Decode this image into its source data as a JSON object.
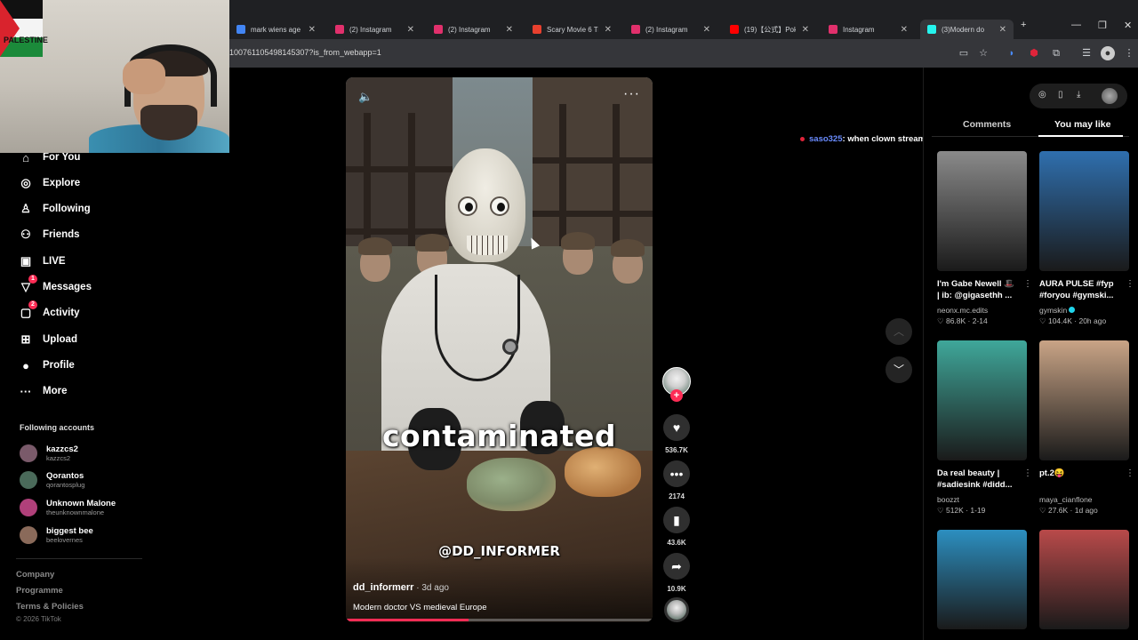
{
  "browser": {
    "tabs": [
      {
        "title": "mark wiens age -",
        "color": "#4285f4"
      },
      {
        "title": "(2) Instagram",
        "color": "#e1306c"
      },
      {
        "title": "(2) Instagram",
        "color": "#e1306c"
      },
      {
        "title": "Scary Movie 6 Tra",
        "color": "#e8402e"
      },
      {
        "title": "(2) Instagram",
        "color": "#e1306c"
      },
      {
        "title": "(19)【公式】Pokém",
        "color": "#ff0000"
      },
      {
        "title": "Instagram",
        "color": "#e1306c"
      },
      {
        "title": "(3)Modern do",
        "color": "#25f4ee"
      }
    ],
    "url": "100761105498145307?is_from_webapp=1"
  },
  "webcam": {
    "flag_text": "PALESTINE"
  },
  "nav": {
    "items": [
      {
        "label": "For You",
        "icon": "home-icon"
      },
      {
        "label": "Explore",
        "icon": "compass-icon"
      },
      {
        "label": "Following",
        "icon": "following-icon"
      },
      {
        "label": "Friends",
        "icon": "friends-icon"
      },
      {
        "label": "LIVE",
        "icon": "live-icon"
      },
      {
        "label": "Messages",
        "icon": "messages-icon",
        "badge": "1"
      },
      {
        "label": "Activity",
        "icon": "activity-icon",
        "badge": "2"
      },
      {
        "label": "Upload",
        "icon": "upload-icon"
      },
      {
        "label": "Profile",
        "icon": "profile-icon"
      },
      {
        "label": "More",
        "icon": "more-icon"
      }
    ],
    "following_title": "Following accounts",
    "accounts": [
      {
        "name": "kazzcs2",
        "handle": "kazzcs2",
        "color": "#7a5a6a"
      },
      {
        "name": "Qorantos",
        "handle": "qorantosplug",
        "color": "#4a6a5a"
      },
      {
        "name": "Unknown Malone",
        "handle": "theunknownmalone",
        "color": "#b0407a"
      },
      {
        "name": "biggest bee",
        "handle": "beelovernes",
        "color": "#8a6a5a"
      }
    ],
    "footer": [
      "Company",
      "Programme",
      "Terms & Policies"
    ],
    "copyright": "© 2026 TikTok"
  },
  "video": {
    "caption_big": "contaminated",
    "watermark": "@DD_INFORMER",
    "author": "dd_informerr",
    "date": " · 3d ago",
    "description": "Modern doctor VS medieval Europe",
    "progress": 0.4
  },
  "actions": {
    "likes": "536.7K",
    "comments": "2174",
    "saves": "43.6K",
    "shares": "10.9K"
  },
  "chat": {
    "user": "saso325",
    "message": ": when clown stream?"
  },
  "panel": {
    "tab_comments": "Comments",
    "tab_like": "You may like",
    "cards": [
      {
        "title": "I'm Gabe Newell 🎩 | ib: @gigasethh ...",
        "author": "neonx.mc.edits",
        "stats": "♡ 86.8K · 2-14",
        "verified": false,
        "bg": "#8a8a8a"
      },
      {
        "title": "AURA PULSE #fyp #foryou #gymski...",
        "author": "gymskin",
        "stats": "♡ 104.4K · 20h ago",
        "verified": true,
        "bg": "#2f6fae"
      },
      {
        "title": "Da real beauty | #sadiesink #didd...",
        "author": "boozzt",
        "stats": "♡ 512K · 1-19",
        "verified": false,
        "bg": "#3fa79a"
      },
      {
        "title": "pt.2😝",
        "author": "maya_cianflone",
        "stats": "♡ 27.6K · 1d ago",
        "verified": false,
        "bg": "#c9a486"
      },
      {
        "title": "",
        "author": "",
        "stats": "",
        "verified": false,
        "bg": "#2c8fc0"
      },
      {
        "title": "",
        "author": "",
        "stats": "",
        "verified": false,
        "bg": "#b94a4a"
      }
    ]
  }
}
